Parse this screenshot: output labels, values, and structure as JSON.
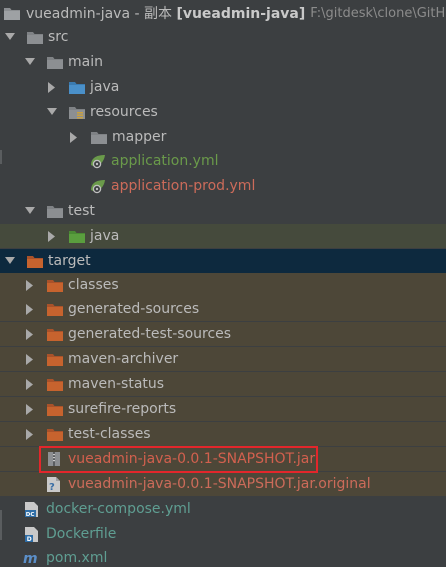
{
  "window": {
    "project_name": "vueadmin-java",
    "separator": " - ",
    "copy_label": "副本",
    "bracket_name": "[vueadmin-java]",
    "path": "F:\\gitdesk\\clone\\GitHub"
  },
  "tree": {
    "src": "src",
    "main": "main",
    "main_java": "java",
    "resources": "resources",
    "mapper": "mapper",
    "application_yml": "application.yml",
    "application_prod_yml": "application-prod.yml",
    "test": "test",
    "test_java": "java",
    "target": "target",
    "classes": "classes",
    "generated_sources": "generated-sources",
    "generated_test_sources": "generated-test-sources",
    "maven_archiver": "maven-archiver",
    "maven_status": "maven-status",
    "surefire_reports": "surefire-reports",
    "test_classes": "test-classes",
    "jar_file": "vueadmin-java-0.0.1-SNAPSHOT.jar",
    "jar_original": "vueadmin-java-0.0.1-SNAPSHOT.jar.original",
    "docker_compose": "docker-compose.yml",
    "dockerfile": "Dockerfile",
    "pom": "pom.xml"
  },
  "colors": {
    "background": "#3c3f41",
    "selection": "#0d293e",
    "test_band": "#454a3c",
    "target_band": "#4d4738",
    "folder_gray": "#8c8f92",
    "folder_blue": "#4a90c9",
    "folder_green": "#5a9e3e",
    "folder_orange": "#c7632e",
    "highlight": "#e3262b"
  }
}
